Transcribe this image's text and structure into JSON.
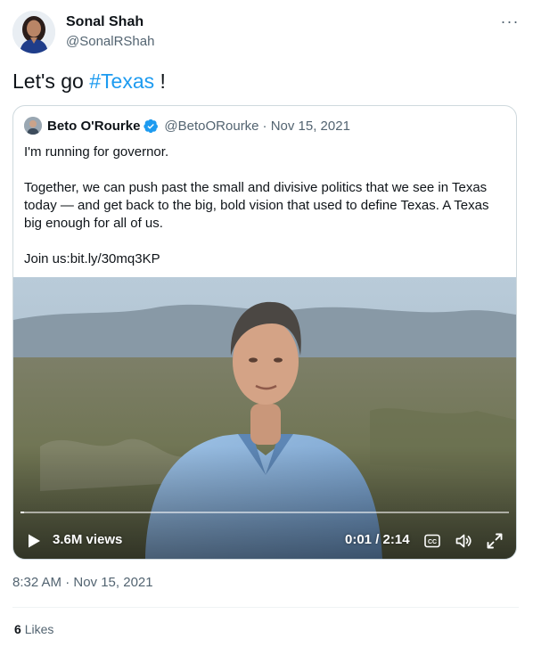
{
  "author": {
    "name": "Sonal Shah",
    "handle": "@SonalRShah"
  },
  "tweet": {
    "text_prefix": "Let's go ",
    "hashtag": "#Texas",
    "text_suffix": " !"
  },
  "quoted": {
    "name": "Beto O'Rourke",
    "handle": "@BetoORourke",
    "date": "· Nov 15, 2021",
    "lines": [
      "I'm running for governor.",
      "Together, we can push past the small and divisive politics that we see in Texas today — and get back to the big, bold vision that used to define Texas. A Texas big enough for all of us.",
      "Join us:bit.ly/30mq3KP"
    ]
  },
  "video": {
    "views": "3.6M views",
    "time": "0:01 / 2:14",
    "progress": 0.008
  },
  "timestamp": "8:32 AM · Nov 15, 2021",
  "likes": {
    "count": "6",
    "label": "Likes"
  },
  "colors": {
    "link": "#1d9bf0",
    "secondary_text": "#536471",
    "border": "#cfd9de",
    "verified": "#1d9bf0"
  },
  "icons": {
    "more": "more-horizontal-icon",
    "verified": "verified-badge-icon",
    "play": "play-icon",
    "captions": "captions-icon",
    "volume": "volume-icon",
    "fullscreen": "fullscreen-icon"
  }
}
